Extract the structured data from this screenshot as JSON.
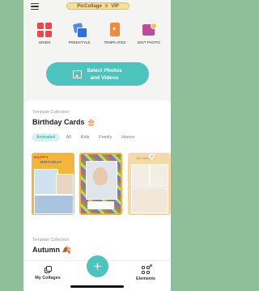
{
  "header": {
    "brand_label": "PicCollage",
    "brand_suffix": "VIP",
    "brand_crown": "♛"
  },
  "tools": [
    {
      "label": "GRIDS",
      "icon": "grids-icon",
      "color": "#e8474d"
    },
    {
      "label": "FREESTYLE",
      "icon": "freestyle-icon",
      "color": "#2f6fe0"
    },
    {
      "label": "TEMPLATES",
      "icon": "templates-icon",
      "color": "#f08a3c"
    },
    {
      "label": "EDIT PHOTO",
      "icon": "edit-photo-icon",
      "color": "#c04a9a"
    }
  ],
  "select_button": {
    "line1": "Select Photos",
    "line2": "and Videos",
    "color": "#4cc3bd"
  },
  "collection1": {
    "kicker": "Template Collection",
    "title": "Birthday Cards 🎂",
    "chips": [
      "Animated",
      "All",
      "Kids",
      "Family",
      "Humor"
    ],
    "active_chip": "Animated",
    "thumb1_line1": "HAPPY",
    "thumb1_line2": "BIRTHDAY",
    "thumb3_header": "JUL  JUN  DEC",
    "pro_badge": "♛"
  },
  "collection2": {
    "kicker": "Template Collection",
    "title": "Autumn 🍂"
  },
  "nav": {
    "collages_label": "My Collages",
    "elements_label": "Elements",
    "add_symbol": "+"
  },
  "colors": {
    "accent": "#4cc3bd",
    "background": "#8fbf99"
  }
}
